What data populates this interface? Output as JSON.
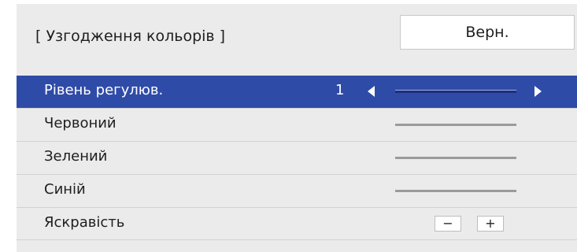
{
  "header": {
    "title": "[ Узгодження кольорів ]",
    "back_label": "Верн."
  },
  "rows": [
    {
      "label": "Рівень регулюв.",
      "value": "1",
      "selected": true,
      "control": "slider-with-arrows"
    },
    {
      "label": "Червоний",
      "control": "slider"
    },
    {
      "label": "Зелений",
      "control": "slider"
    },
    {
      "label": "Синій",
      "control": "slider"
    },
    {
      "label": "Яскравість",
      "control": "stepper",
      "minus_label": "−",
      "plus_label": "+"
    }
  ],
  "colors": {
    "panel_bg": "#ebebeb",
    "selected_bg": "#2f4ba8",
    "text": "#1e1e1e"
  },
  "icons": {
    "left_arrow": "triangle-left-icon",
    "right_arrow": "triangle-right-icon"
  }
}
